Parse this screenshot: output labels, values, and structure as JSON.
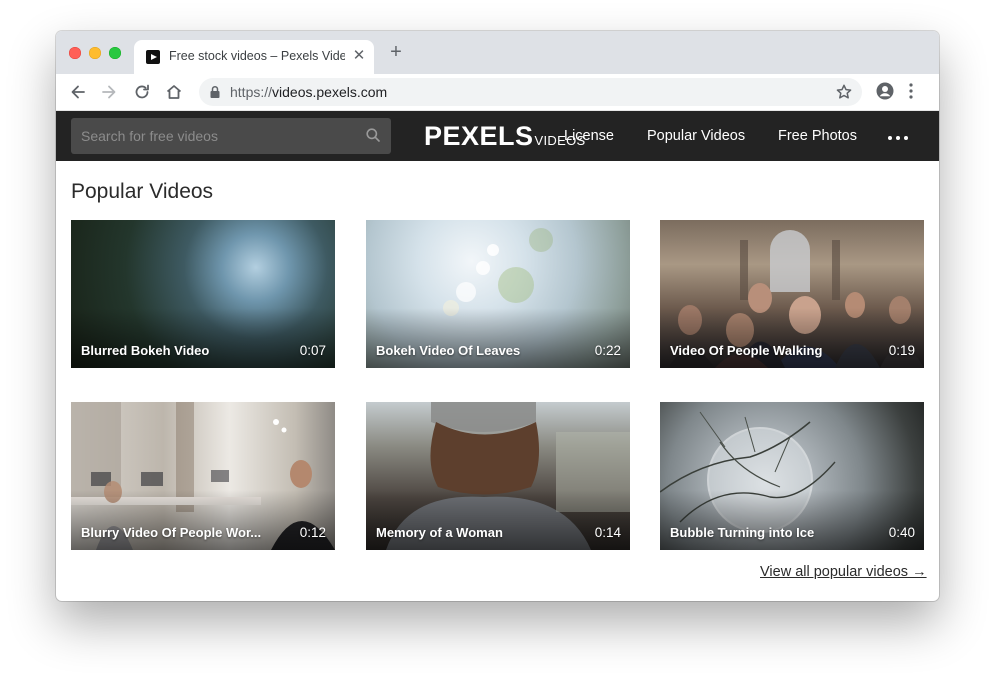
{
  "browser": {
    "tab": {
      "title": "Free stock videos – Pexels Videos",
      "close_glyph": "✕",
      "favicon_icon": "play-icon"
    },
    "new_tab_glyph": "+",
    "address_bar": {
      "scheme": "https://",
      "host": "videos.pexels.com"
    }
  },
  "site": {
    "search_placeholder": "Search for free videos",
    "logo": {
      "main": "PEXELS",
      "sub": "VIDEOS"
    },
    "nav": {
      "license": "License",
      "popular_videos": "Popular Videos",
      "free_photos": "Free Photos"
    }
  },
  "content": {
    "heading": "Popular Videos",
    "videos": [
      {
        "title": "Blurred Bokeh Video",
        "duration": "0:07"
      },
      {
        "title": "Bokeh Video Of Leaves",
        "duration": "0:22"
      },
      {
        "title": "Video Of People Walking",
        "duration": "0:19"
      },
      {
        "title": "Blurry Video Of People Wor...",
        "duration": "0:12"
      },
      {
        "title": "Memory of a Woman",
        "duration": "0:14"
      },
      {
        "title": "Bubble Turning into Ice",
        "duration": "0:40"
      }
    ],
    "view_all": "View all popular videos →"
  },
  "colors": {
    "site_nav_bg": "#232323",
    "search_bg": "#4a4a4a",
    "tabstrip_bg": "#dee1e6",
    "omnibox_bg": "#f1f3f4"
  }
}
